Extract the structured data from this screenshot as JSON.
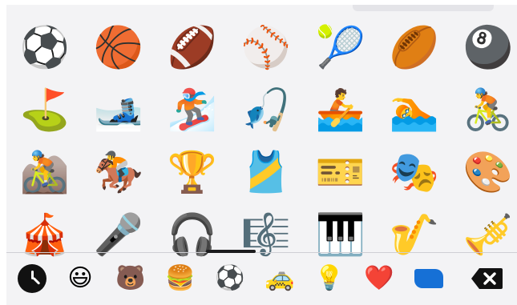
{
  "keyboard": {
    "emoji_grid": [
      [
        "⚽",
        "🏀",
        "🏈",
        "⚾",
        "🎾",
        "🏉",
        "🎱"
      ],
      [
        "⛳",
        "🎿",
        "🏂",
        "🎣",
        "🚣",
        "🏊",
        "🚴"
      ],
      [
        "🚵",
        "🏇",
        "🏆",
        "🎽",
        "🎫",
        "🎭",
        "🎨"
      ],
      [
        "🎪",
        "🎤",
        "🎧",
        "🎼",
        "🎹",
        "🎷",
        "🎺"
      ]
    ],
    "categories": [
      {
        "name": "recent",
        "glyph": "clock-icon",
        "selected": false
      },
      {
        "name": "smileys",
        "glyph": "😃",
        "selected": false
      },
      {
        "name": "animals",
        "glyph": "🐻",
        "selected": false
      },
      {
        "name": "food",
        "glyph": "🍔",
        "selected": false
      },
      {
        "name": "activity",
        "glyph": "⚽",
        "selected": true
      },
      {
        "name": "travel",
        "glyph": "🚕",
        "selected": false
      },
      {
        "name": "objects",
        "glyph": "💡",
        "selected": false
      },
      {
        "name": "symbols",
        "glyph": "❤️",
        "selected": false
      },
      {
        "name": "flags",
        "glyph": "flag-icon",
        "selected": false
      },
      {
        "name": "delete",
        "glyph": "backspace-icon",
        "selected": false
      }
    ]
  }
}
